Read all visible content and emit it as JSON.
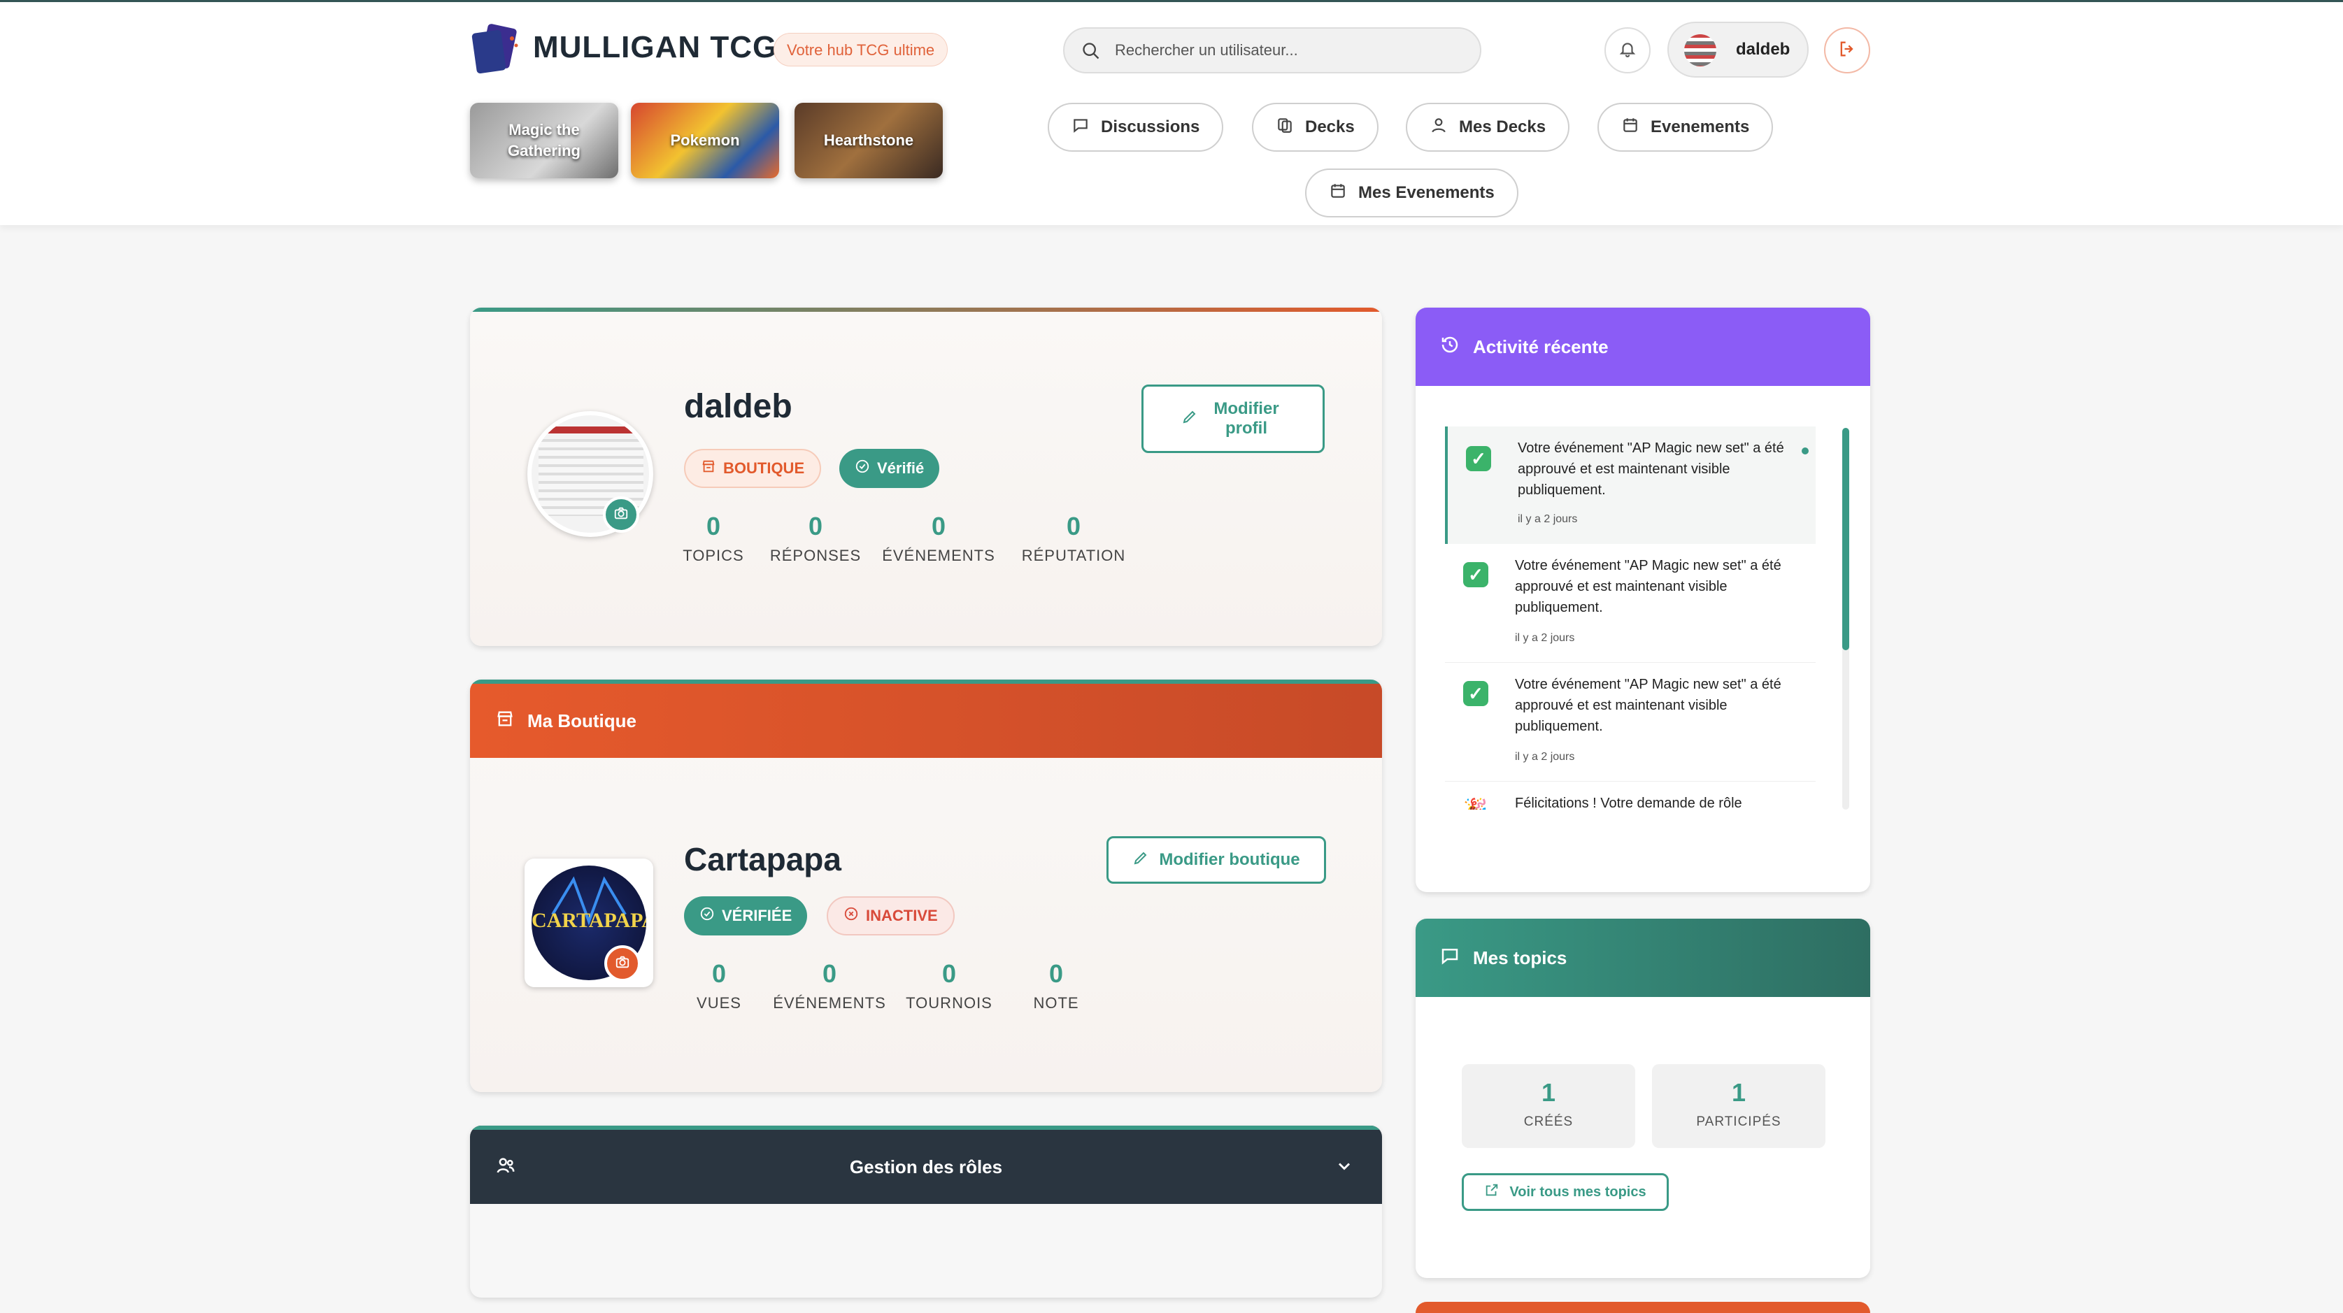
{
  "header": {
    "logo_text": "MULLIGAN TCG",
    "tagline": "Votre hub TCG ultime",
    "search_placeholder": "Rechercher un utilisateur...",
    "username": "daldeb",
    "games": [
      {
        "label": "Magic the Gathering"
      },
      {
        "label": "Pokemon"
      },
      {
        "label": "Hearthstone"
      }
    ],
    "nav": [
      {
        "label": "Discussions",
        "icon": "chat-icon"
      },
      {
        "label": "Decks",
        "icon": "cards-icon"
      },
      {
        "label": "Mes Decks",
        "icon": "user-icon"
      },
      {
        "label": "Evenements",
        "icon": "calendar-icon"
      },
      {
        "label": "Mes Evenements",
        "icon": "calendar-icon"
      }
    ]
  },
  "profile": {
    "name": "daldeb",
    "badge_shop": "BOUTIQUE",
    "badge_verified": "Vérifié",
    "edit_label": "Modifier profil",
    "stats": [
      {
        "value": "0",
        "label": "TOPICS"
      },
      {
        "value": "0",
        "label": "RÉPONSES"
      },
      {
        "value": "0",
        "label": "ÉVÉNEMENTS"
      },
      {
        "value": "0",
        "label": "RÉPUTATION"
      }
    ]
  },
  "shop": {
    "section_title": "Ma Boutique",
    "name": "Cartapapa",
    "logo_text": "CARTAPAPA",
    "badge_verified": "VÉRIFIÉE",
    "badge_inactive": "INACTIVE",
    "edit_label": "Modifier boutique",
    "stats": [
      {
        "value": "0",
        "label": "VUES"
      },
      {
        "value": "0",
        "label": "ÉVÉNEMENTS"
      },
      {
        "value": "0",
        "label": "TOURNOIS"
      },
      {
        "value": "0",
        "label": "NOTE"
      }
    ]
  },
  "roles": {
    "title": "Gestion des rôles"
  },
  "activity": {
    "title": "Activité récente",
    "items": [
      {
        "text": "Votre événement \"AP Magic new set\" a été approuvé et est maintenant visible publiquement.",
        "time": "il y a 2 jours"
      },
      {
        "text": "Votre événement \"AP Magic new set\" a été approuvé et est maintenant visible publiquement.",
        "time": "il y a 2 jours"
      },
      {
        "text": "Votre événement \"AP Magic new set\" a été approuvé et est maintenant visible publiquement.",
        "time": "il y a 2 jours"
      },
      {
        "text": "Félicitations ! Votre demande de rôle",
        "time": ""
      }
    ]
  },
  "topics": {
    "title": "Mes topics",
    "created_value": "1",
    "created_label": "CRÉÉS",
    "participated_value": "1",
    "participated_label": "PARTICIPÉS",
    "view_all": "Voir tous mes topics"
  },
  "colors": {
    "teal": "#3a9a86",
    "orange": "#e25a2c",
    "purple": "#8b5cf6",
    "dark": "#2a3540"
  }
}
